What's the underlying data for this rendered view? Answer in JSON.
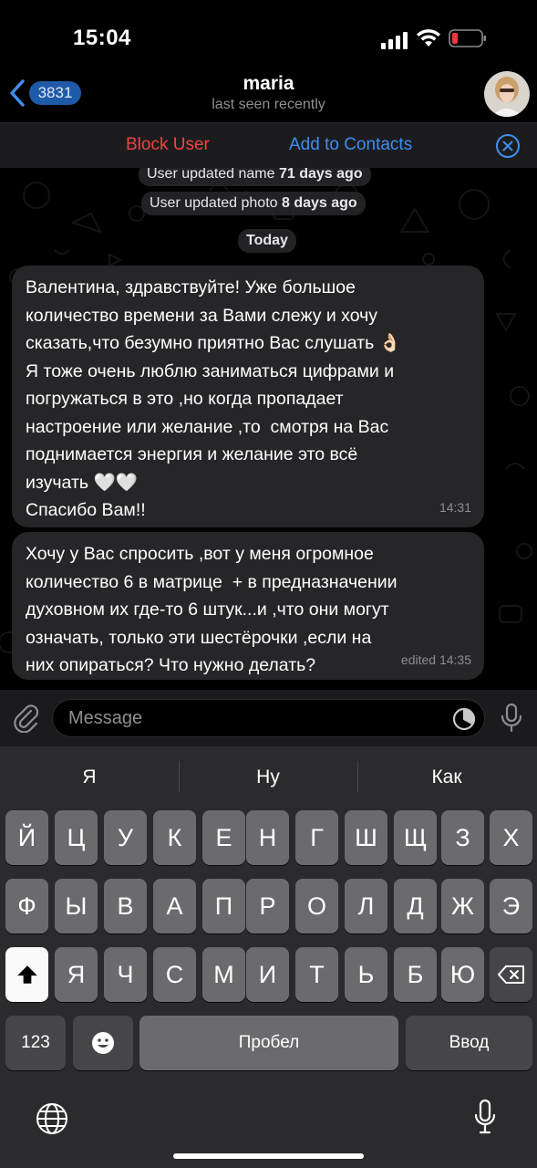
{
  "status_bar": {
    "time": "15:04"
  },
  "header": {
    "back_count": "3831",
    "name": "maria",
    "subtitle": "last seen recently"
  },
  "action_bar": {
    "block_label": "Block User",
    "add_label": "Add to Contacts"
  },
  "service_messages": [
    {
      "prefix": "User updated name ",
      "suffix": "71 days ago"
    },
    {
      "prefix": "User updated photo ",
      "suffix": "8 days ago"
    },
    {
      "prefix": "Today",
      "suffix": ""
    }
  ],
  "messages": [
    {
      "text": "Валентина, здравствуйте! Уже большое\nколичество времени за Вами слежу и хочу\nсказать,что безумно приятно Вас слушать 👌🏻\nЯ тоже очень люблю заниматься цифрами и\nпогружаться в это ,но когда пропадает\nнастроение или желание ,то  смотря на Вас\nподнимается энергия и желание это всё\nизучать 🤍🤍\nСпасибо Вам!!",
      "time": "14:31"
    },
    {
      "text": "Хочу у Вас спросить ,вот у меня огромное\nколичество 6 в матрице  + в предназначении\nдуховном их где-то 6 штук...и ,что они могут\nозначать, только эти шестёрочки ,если на\nних опираться? Что нужно делать?",
      "time": "edited 14:35"
    }
  ],
  "input": {
    "placeholder": "Message"
  },
  "keyboard": {
    "suggestions": [
      "Я",
      "Ну",
      "Как"
    ],
    "row1": [
      "Й",
      "Ц",
      "У",
      "К",
      "Е",
      "Н",
      "Г",
      "Ш",
      "Щ",
      "З",
      "Х"
    ],
    "row2": [
      "Ф",
      "Ы",
      "В",
      "А",
      "П",
      "Р",
      "О",
      "Л",
      "Д",
      "Ж",
      "Э"
    ],
    "row3": [
      "Я",
      "Ч",
      "С",
      "М",
      "И",
      "Т",
      "Ь",
      "Б",
      "Ю"
    ],
    "numbers_label": "123",
    "space_label": "Пробел",
    "return_label": "Ввод"
  },
  "colors": {
    "block": "#ef4343",
    "link": "#3f8ef0",
    "bubble": "#262628",
    "keyboard": "#2b2b2d"
  },
  "icons": [
    "back-chevron-icon",
    "close-circle-icon",
    "paperclip-icon",
    "sticker-clock-icon",
    "microphone-icon",
    "shift-icon",
    "backspace-icon",
    "emoji-icon",
    "globe-icon"
  ]
}
